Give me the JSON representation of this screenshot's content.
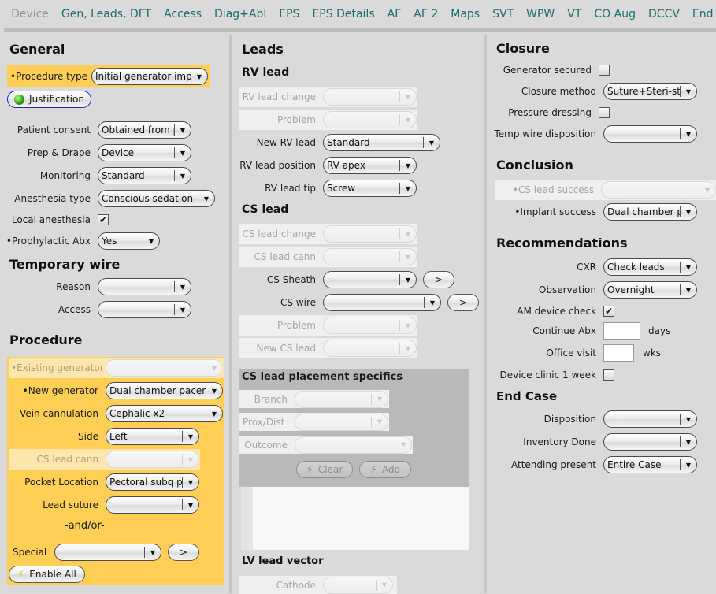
{
  "tabs": [
    {
      "label": "Device",
      "active": true
    },
    {
      "label": "Gen, Leads, DFT"
    },
    {
      "label": "Access"
    },
    {
      "label": "Diag+Abl"
    },
    {
      "label": "EPS"
    },
    {
      "label": "EPS Details"
    },
    {
      "label": "AF"
    },
    {
      "label": "AF 2"
    },
    {
      "label": "Maps"
    },
    {
      "label": "SVT"
    },
    {
      "label": "WPW"
    },
    {
      "label": "VT"
    },
    {
      "label": "CO Aug"
    },
    {
      "label": "DCCV"
    },
    {
      "label": "End"
    }
  ],
  "general": {
    "title": "General",
    "procedure_type": {
      "label": "•Procedure type",
      "value": "Initial generator impla"
    },
    "justification_label": "Justification",
    "patient_consent": {
      "label": "Patient consent",
      "value": "Obtained from p"
    },
    "prep_drape": {
      "label": "Prep & Drape",
      "value": "Device"
    },
    "monitoring": {
      "label": "Monitoring",
      "value": "Standard"
    },
    "anesthesia_type": {
      "label": "Anesthesia type",
      "value": "Conscious sedation"
    },
    "local_anesthesia": {
      "label": "Local anesthesia",
      "checked": true,
      "mark": "✔"
    },
    "prophylactic_abx": {
      "label": "•Prophylactic Abx",
      "value": "Yes"
    }
  },
  "temporary_wire": {
    "title": "Temporary wire",
    "reason": {
      "label": "Reason",
      "value": ""
    },
    "access": {
      "label": "Access",
      "value": ""
    }
  },
  "procedure": {
    "title": "Procedure",
    "existing_generator": {
      "label": "•Existing generator",
      "value": ""
    },
    "new_generator": {
      "label": "•New generator",
      "value": "Dual chamber pacer"
    },
    "vein_cannulation": {
      "label": "Vein cannulation",
      "value": "Cephalic x2"
    },
    "side": {
      "label": "Side",
      "value": "Left"
    },
    "cs_lead_cann": {
      "label": "CS lead cann",
      "value": ""
    },
    "pocket_location": {
      "label": "Pocket Location",
      "value": "Pectoral subq p/"
    },
    "lead_suture": {
      "label": "Lead suture",
      "value": ""
    },
    "and_or": "-and/or-",
    "special": {
      "label": "Special",
      "value": "",
      "go_label": ">"
    },
    "enable_all_label": "Enable All"
  },
  "leads": {
    "title": "Leads",
    "rv_title": "RV lead",
    "rv_lead_change": {
      "label": "RV lead change",
      "value": ""
    },
    "rv_problem": {
      "label": "Problem",
      "value": ""
    },
    "new_rv_lead": {
      "label": "New RV lead",
      "value": "Standard"
    },
    "rv_lead_position": {
      "label": "RV lead position",
      "value": "RV apex"
    },
    "rv_lead_tip": {
      "label": "RV lead tip",
      "value": "Screw"
    },
    "cs_title": "CS lead",
    "cs_lead_change": {
      "label": "CS lead change",
      "value": ""
    },
    "cs_lead_cann": {
      "label": "CS lead cann",
      "value": ""
    },
    "cs_sheath": {
      "label": "CS Sheath",
      "value": "",
      "go_label": ">"
    },
    "cs_wire": {
      "label": "CS wire",
      "value": "",
      "go_label": ">"
    },
    "cs_problem": {
      "label": "Problem",
      "value": ""
    },
    "new_cs_lead": {
      "label": "New CS lead",
      "value": ""
    },
    "specifics": {
      "title": "CS lead placement specifics",
      "branch": {
        "label": "Branch",
        "value": ""
      },
      "prox_dist": {
        "label": "Prox/Dist",
        "value": ""
      },
      "outcome": {
        "label": "Outcome",
        "value": ""
      },
      "clear_label": "Clear",
      "add_label": "Add"
    },
    "lv_title": "LV lead vector",
    "cathode": {
      "label": "Cathode",
      "value": ""
    }
  },
  "closure": {
    "title": "Closure",
    "generator_secured": {
      "label": "Generator secured",
      "checked": false
    },
    "closure_method": {
      "label": "Closure method",
      "value": "Suture+Steri-str"
    },
    "pressure_dressing": {
      "label": "Pressure dressing",
      "checked": false
    },
    "temp_wire_disposition": {
      "label": "Temp wire disposition",
      "value": ""
    }
  },
  "conclusion": {
    "title": "Conclusion",
    "cs_lead_success": {
      "label": "•CS lead success",
      "value": ""
    },
    "implant_success": {
      "label": "•Implant success",
      "value": "Dual chamber pa"
    }
  },
  "recommendations": {
    "title": "Recommendations",
    "cxr": {
      "label": "CXR",
      "value": "Check leads"
    },
    "observation": {
      "label": "Observation",
      "value": "Overnight"
    },
    "am_device_check": {
      "label": "AM device check",
      "checked": true,
      "mark": "✔"
    },
    "continue_abx": {
      "label": "Continue Abx",
      "value": "",
      "unit": "days"
    },
    "office_visit": {
      "label": "Office visit",
      "value": "",
      "unit": "wks"
    },
    "device_clinic": {
      "label": "Device clinic 1 week",
      "checked": false
    }
  },
  "end_case": {
    "title": "End Case",
    "disposition": {
      "label": "Disposition",
      "value": ""
    },
    "inventory_done": {
      "label": "Inventory Done",
      "value": ""
    },
    "attending_present": {
      "label": "Attending present",
      "value": "Entire Case"
    }
  },
  "icons": {
    "dropdown": "▼",
    "bolt": "⚡"
  }
}
